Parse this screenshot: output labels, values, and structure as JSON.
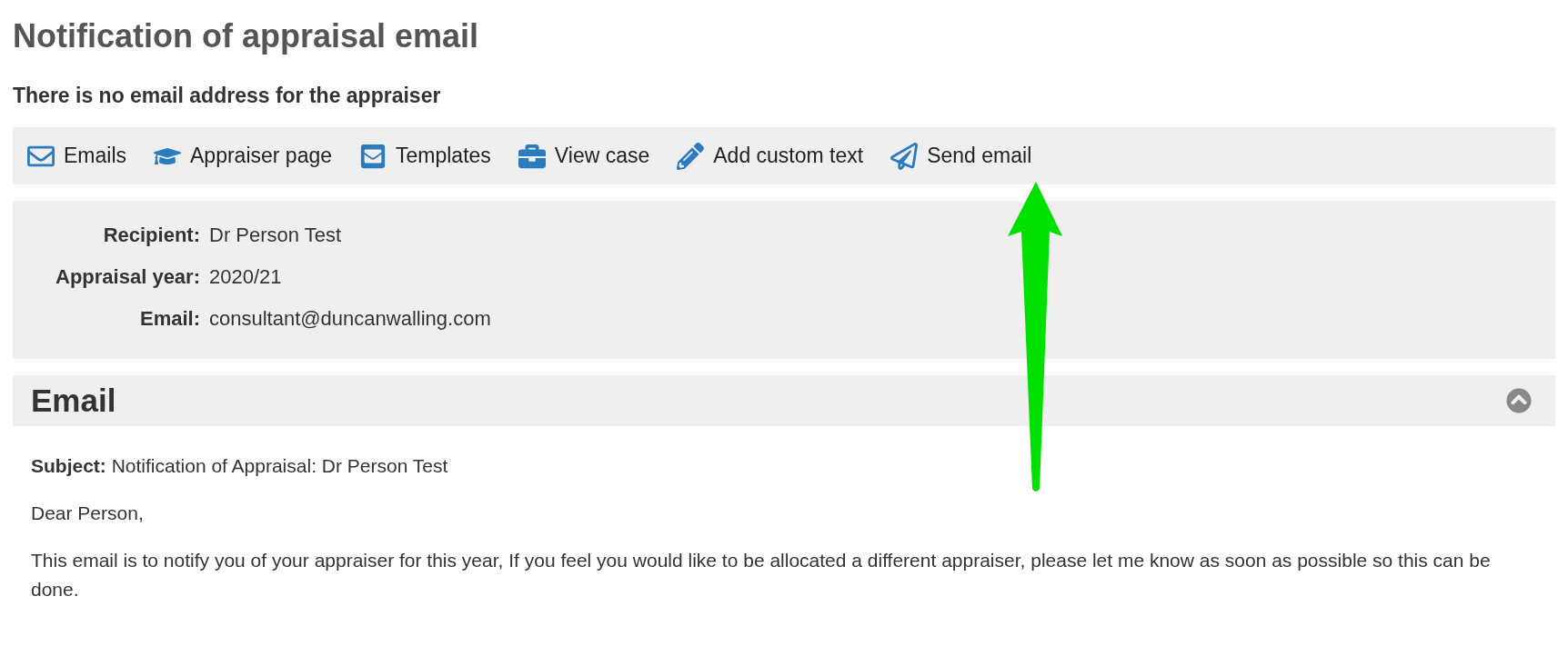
{
  "page": {
    "title": "Notification of appraisal email",
    "warning": "There is no email address for the appraiser"
  },
  "toolbar": [
    {
      "kind": "envelope",
      "label": "Emails"
    },
    {
      "kind": "cap",
      "label": "Appraiser page"
    },
    {
      "kind": "template",
      "label": "Templates"
    },
    {
      "kind": "briefcase",
      "label": "View case"
    },
    {
      "kind": "pencil",
      "label": "Add custom text"
    },
    {
      "kind": "plane",
      "label": "Send email"
    }
  ],
  "details": [
    {
      "label": "Recipient:",
      "value": "Dr Person Test"
    },
    {
      "label": "Appraisal year:",
      "value": "2020/21"
    },
    {
      "label": "Email:",
      "value": "consultant@duncanwalling.com"
    }
  ],
  "section": {
    "title": "Email",
    "expanded": true
  },
  "email": {
    "subject": "**Subject:** Notification of Appraisal: Dr Person Test",
    "paragraphs": [
      "Dear Person,",
      "This email is to notify you of your appraiser for this year, If you feel you would like to be allocated a different appraiser, please let me know as soon as possible so this can be done."
    ]
  }
}
